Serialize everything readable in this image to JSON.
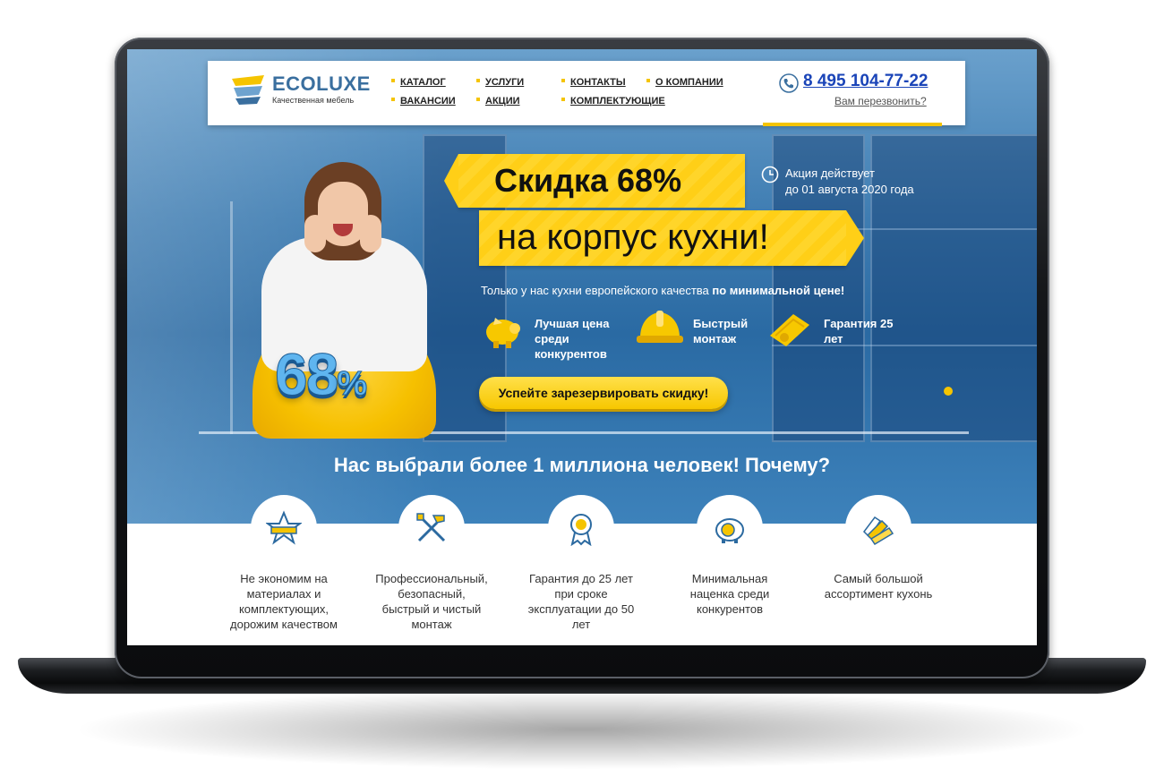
{
  "brand": {
    "name": "ECOLUXE",
    "tagline": "Качественная мебель"
  },
  "nav": {
    "items": [
      "КАТАЛОГ",
      "УСЛУГИ",
      "КОНТАКТЫ",
      "О КОМПАНИИ",
      "ВАКАНСИИ",
      "АКЦИИ",
      "КОМПЛЕКТУЮЩИЕ"
    ]
  },
  "contact": {
    "phone": "8 495 104-77-22",
    "callback": "Вам перезвонить?"
  },
  "promo": {
    "headline": "Скидка 68%",
    "subheadline": "на корпус кухни!",
    "note_line1": "Акция действует",
    "note_line2": "до 01 августа 2020 года",
    "badge_number": "68",
    "badge_percent": "%",
    "description_plain": "Только у нас кухни европейского качества ",
    "description_bold": "по минимальной цене!",
    "cta": "Успейте зарезервировать скидку!"
  },
  "hero_features": [
    {
      "icon": "piggy-bank-icon",
      "line1": "Лучшая цена",
      "line2": "среди",
      "line3": "конкурентов"
    },
    {
      "icon": "hard-hat-icon",
      "line1": "Быстрый",
      "line2": "монтаж"
    },
    {
      "icon": "certificate-icon",
      "line1": "Гарантия 25",
      "line2": "лет"
    }
  ],
  "why": {
    "title": "Нас выбрали более 1 миллиона человек! Почему?",
    "items": [
      {
        "icon": "star-icon",
        "line1": "Не экономим на",
        "line2": "материалах и",
        "line3": "комплектующих,",
        "line4": "дорожим качеством"
      },
      {
        "icon": "tools-icon",
        "line1": "Профессиональный,",
        "line2": "безопасный,",
        "line3": "быстрый и чистый",
        "line4": "монтаж"
      },
      {
        "icon": "medal-icon",
        "line1": "Гарантия до 25 лет",
        "line2": "при сроке",
        "line3": "эксплуатации до 50",
        "line4": "лет"
      },
      {
        "icon": "piggy-coin-icon",
        "line1": "Минимальная",
        "line2": "наценка среди",
        "line3": "конкурентов"
      },
      {
        "icon": "color-swatches-icon",
        "line1": "Самый большой",
        "line2": "ассортимент кухонь"
      }
    ]
  },
  "colors": {
    "accent": "#f5c400",
    "brand_blue": "#3a6f9f",
    "phone_blue": "#1a44b8",
    "hero_blue": "#2a6aa3"
  }
}
